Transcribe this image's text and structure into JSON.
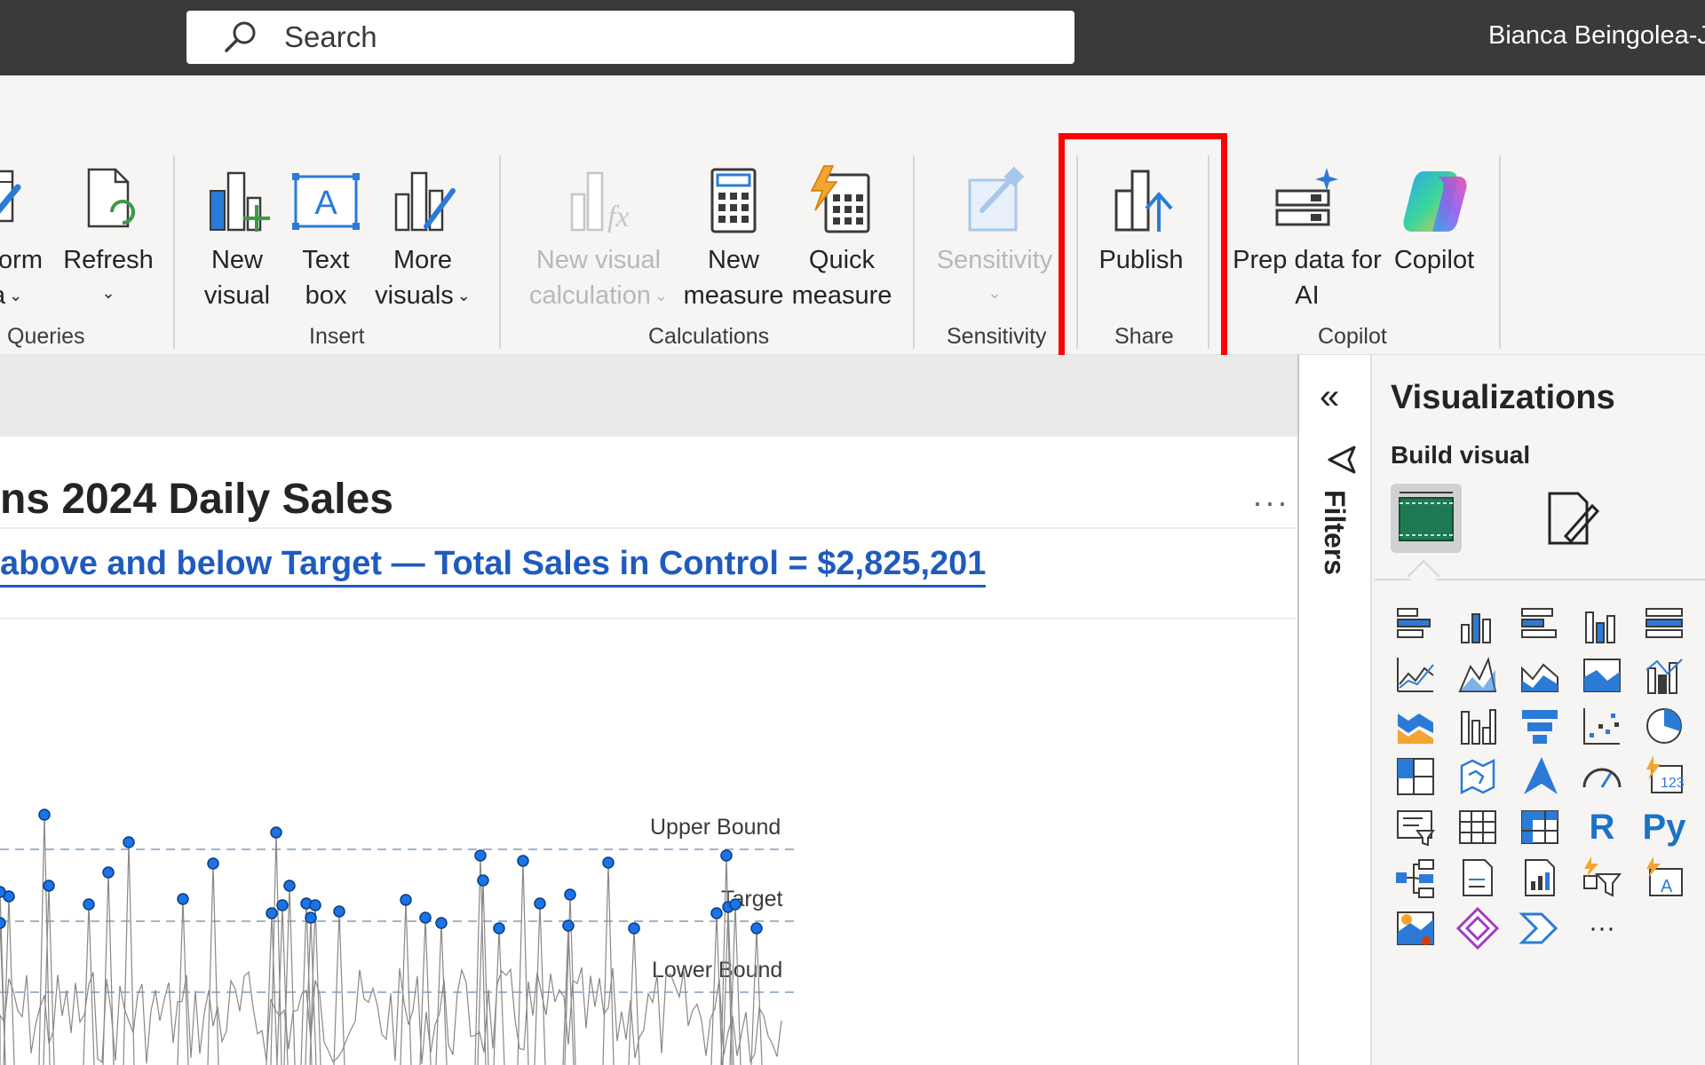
{
  "titlebar": {
    "search_placeholder": "Search",
    "user_name": "Bianca Beingolea-J"
  },
  "ribbon": {
    "queries": {
      "transform_label_line1": "form",
      "transform_label_line2": "a",
      "refresh_label": "Refresh",
      "group_label": "Queries"
    },
    "insert": {
      "new_visual_line1": "New",
      "new_visual_line2": "visual",
      "text_box_line1": "Text",
      "text_box_line2": "box",
      "more_visuals_line1": "More",
      "more_visuals_line2": "visuals",
      "group_label": "Insert"
    },
    "calculations": {
      "new_visual_calc_line1": "New visual",
      "new_visual_calc_line2": "calculation",
      "new_measure_line1": "New",
      "new_measure_line2": "measure",
      "quick_measure_line1": "Quick",
      "quick_measure_line2": "measure",
      "group_label": "Calculations"
    },
    "sensitivity": {
      "sensitivity_label": "Sensitivity",
      "group_label": "Sensitivity"
    },
    "share": {
      "publish_label": "Publish",
      "group_label": "Share"
    },
    "copilot": {
      "prep_data_line1": "Prep data for",
      "prep_data_line2": "AI",
      "copilot_label": "Copilot",
      "group_label": "Copilot"
    }
  },
  "report": {
    "visual_title": "ns 2024 Daily Sales",
    "more_options": "···",
    "subtitle": "above and below Target —  Total Sales in Control =  $2,825,201",
    "chart": {
      "upper_label": "Upper Bound",
      "target_label": "Target",
      "lower_label": "Lower Bound"
    }
  },
  "chart_data": {
    "type": "line",
    "title": "ns 2024 Daily Sales",
    "reference_lines": [
      "Upper Bound",
      "Target",
      "Lower Bound"
    ],
    "series_color": "#1a73e8"
  },
  "filters": {
    "label": "Filters",
    "collapse_glyph": "«"
  },
  "visualizations": {
    "title": "Visualizations",
    "build_visual": "Build visual",
    "icons": [
      "stacked-bar-chart-icon",
      "stacked-column-chart-icon",
      "clustered-bar-chart-icon",
      "clustered-column-chart-icon",
      "100-stacked-bar-chart-icon",
      "line-chart-icon",
      "area-chart-icon",
      "stacked-area-chart-icon",
      "100-stacked-area-chart-icon",
      "line-and-column-chart-icon",
      "ribbon-chart-icon",
      "waterfall-chart-icon",
      "funnel-chart-icon",
      "scatter-chart-icon",
      "pie-chart-icon",
      "treemap-icon",
      "map-icon",
      "azure-map-icon",
      "gauge-icon",
      "card-icon",
      "slicer-icon",
      "table-icon",
      "matrix-icon",
      "r-visual-icon",
      "python-visual-icon",
      "decomposition-tree-icon",
      "paginated-report-icon",
      "narrative-icon",
      "key-influencers-icon",
      "smart-narrative-icon",
      "arcgis-map-icon",
      "power-apps-icon",
      "power-automate-icon",
      "more-visuals-icon"
    ],
    "r_text": "R",
    "py_text": "Py",
    "more_text": "···"
  },
  "colors": {
    "titlebar": "#3b3a39",
    "ribbon": "#f6f5f4",
    "accent_blue": "#1f5bbf",
    "highlight_red": "#ff0000"
  }
}
